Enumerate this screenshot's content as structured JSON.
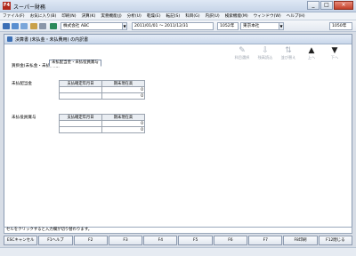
{
  "window": {
    "icon_text": "F4",
    "title": "スーパー財務",
    "minimize": "_",
    "maximize": "□",
    "close": "×"
  },
  "menu": [
    "ファイル(F)",
    "お気に入り(B)",
    "印刷(N)",
    "決算(K)",
    "実務機能(J)",
    "分析(U)",
    "乾燥(E)",
    "転記(S)",
    "科目(G)",
    "内訳(U)",
    "検索機能(M)",
    "ウィンドウ(W)",
    "ヘルプ(H)"
  ],
  "toolbar": {
    "company": "株式会社 ABC",
    "period": "2011/01/01 ～ 2011/12/31",
    "dept_code": "1052年",
    "dept_name": "東京本社",
    "right_value": "1050年"
  },
  "child_window": {
    "title": "決算書 (未払金・未払費用) の内訳書"
  },
  "actions": [
    {
      "label": "科目選択",
      "glyph": "✎"
    },
    {
      "label": "残高読込",
      "glyph": "⇩"
    },
    {
      "label": "並び替え",
      "glyph": "⇅"
    },
    {
      "label": "上へ",
      "glyph": "▲"
    },
    {
      "label": "下へ",
      "glyph": "▼"
    }
  ],
  "form": {
    "section_label": "買掛金(未払金・未払費用)",
    "tabs": [
      "未払配当金・未払役員賞与"
    ],
    "groups": [
      {
        "label": "未払配当金",
        "headers": [
          "支払確定年月日",
          "期末現在高"
        ],
        "rows": [
          [
            "",
            "0"
          ],
          [
            "",
            "0"
          ]
        ]
      },
      {
        "label": "未払役員賞与",
        "headers": [
          "支払確定年月日",
          "期末現在高"
        ],
        "rows": [
          [
            "",
            "0"
          ],
          [
            "",
            "0"
          ]
        ]
      }
    ]
  },
  "hint": "セルをクリックすると入力欄が切り替わります。",
  "fkeys": [
    "ESCキャンセル",
    "F1ヘルプ",
    "F2",
    "F3",
    "F4",
    "F5",
    "F6",
    "F7",
    "F8印刷",
    "F12閉じる"
  ]
}
